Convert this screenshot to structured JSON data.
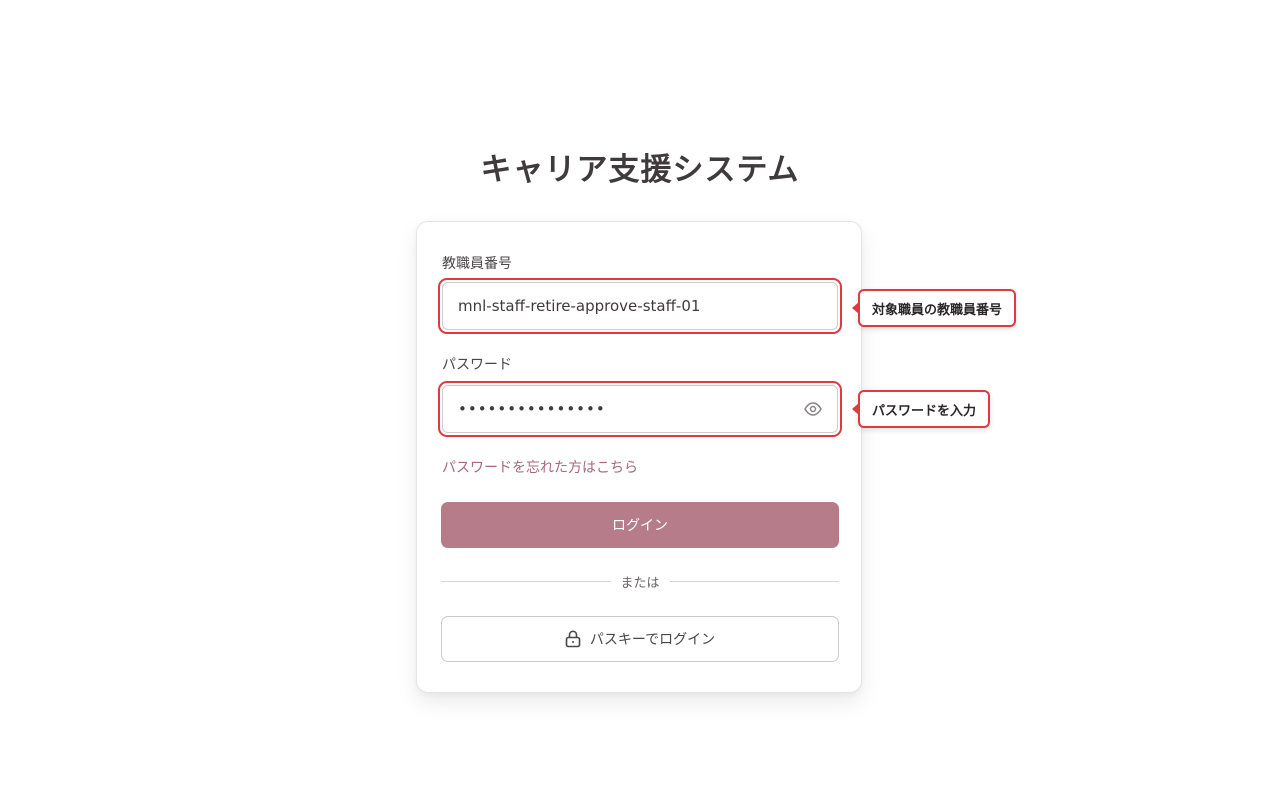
{
  "app": {
    "title": "キャリア支援システム"
  },
  "login_form": {
    "staff_id": {
      "label": "教職員番号",
      "value": "mnl-staff-retire-approve-staff-01"
    },
    "password": {
      "label": "パスワード",
      "value": "•••••••••••••••",
      "toggle_icon": "eye-icon"
    },
    "forgot_password_link": "パスワードを忘れた方はこちら",
    "login_button": "ログイン",
    "divider_text": "または",
    "passkey_button": {
      "label": "パスキーでログイン",
      "icon": "lock-icon"
    }
  },
  "annotations": {
    "staff_id_callout": "対象職員の教職員番号",
    "password_callout": "パスワードを入力"
  },
  "colors": {
    "primary_button": "#b77c89",
    "link": "#a8677a",
    "highlight": "#e0393f",
    "title_text": "#3f3a3c"
  }
}
